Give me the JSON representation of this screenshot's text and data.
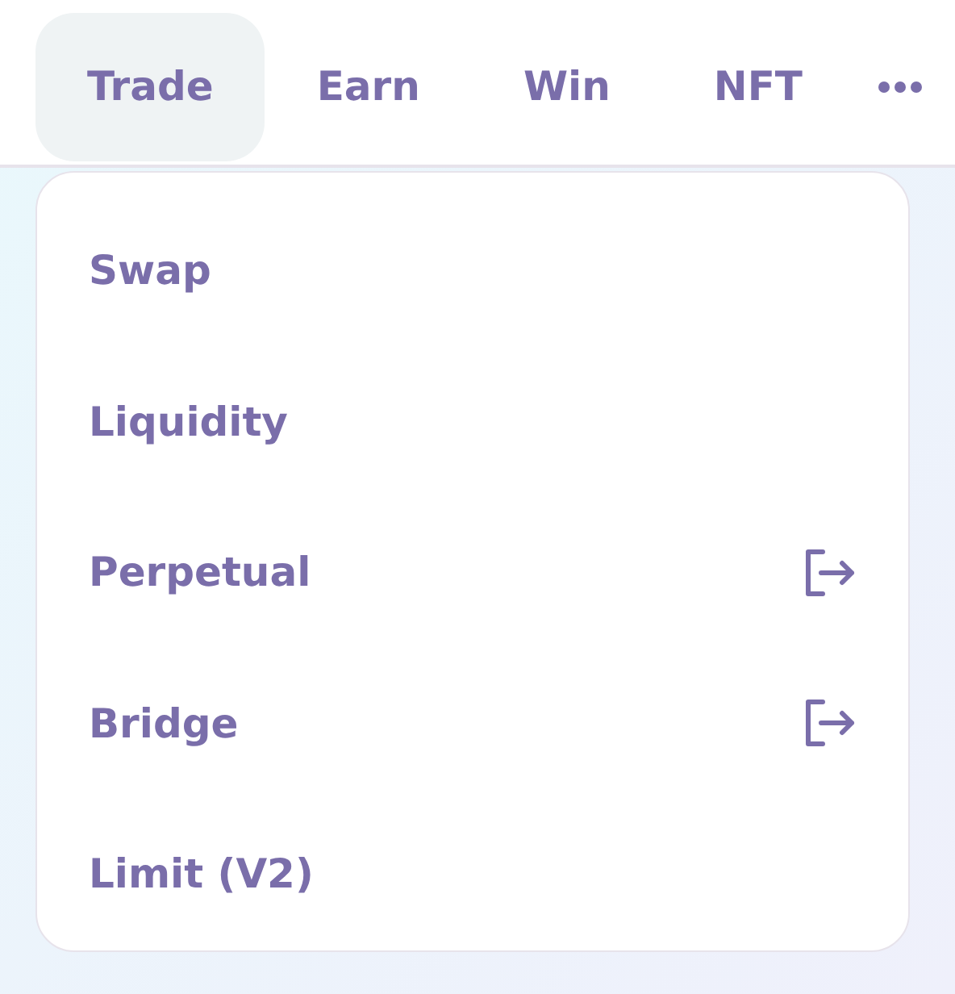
{
  "nav": [
    {
      "label": "Trade",
      "selected": true
    },
    {
      "label": "Earn",
      "selected": false
    },
    {
      "label": "Win",
      "selected": false
    },
    {
      "label": "NFT",
      "selected": false
    }
  ],
  "menu": [
    {
      "label": "Swap",
      "external": false
    },
    {
      "label": "Liquidity",
      "external": false
    },
    {
      "label": "Perpetual",
      "external": true
    },
    {
      "label": "Bridge",
      "external": true
    },
    {
      "label": "Limit (V2)",
      "external": false
    }
  ]
}
